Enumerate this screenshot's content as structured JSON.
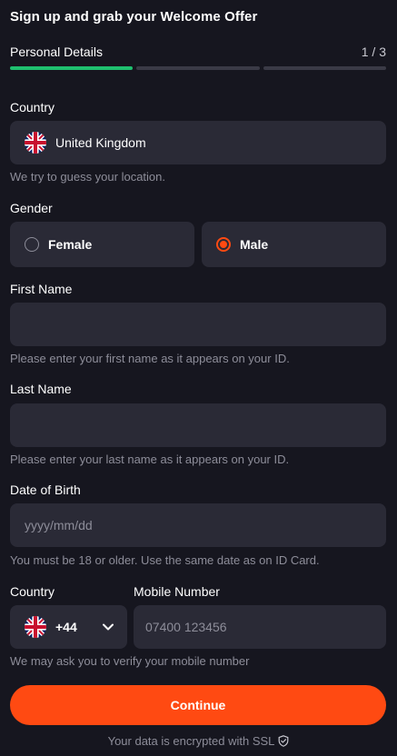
{
  "header": {
    "title": "Sign up and grab your Welcome Offer"
  },
  "steps": {
    "label": "Personal Details",
    "counter": "1 / 3",
    "total": 3,
    "current": 1
  },
  "country": {
    "label": "Country",
    "value": "United Kingdom",
    "flag_icon": "uk-flag-icon",
    "hint": "We try to guess your location."
  },
  "gender": {
    "label": "Gender",
    "options": [
      {
        "label": "Female",
        "selected": false
      },
      {
        "label": "Male",
        "selected": true
      }
    ]
  },
  "first_name": {
    "label": "First Name",
    "value": "",
    "hint": "Please enter your first name as it appears on your ID."
  },
  "last_name": {
    "label": "Last Name",
    "value": "",
    "hint": "Please enter your last name as it appears on your ID."
  },
  "dob": {
    "label": "Date of Birth",
    "placeholder": "yyyy/mm/dd",
    "hint": "You must be 18 or older. Use the same date as on ID Card."
  },
  "phone": {
    "country_label": "Country",
    "code": "+44",
    "mobile_label": "Mobile Number",
    "placeholder": "07400 123456",
    "hint": "We may ask you to verify your mobile number"
  },
  "continue_label": "Continue",
  "footer": {
    "ssl_text": "Your data is encrypted with SSL"
  },
  "colors": {
    "background": "#16161f",
    "field": "#2a2a36",
    "accent": "#ff4a12",
    "progress_active": "#1fbf6f",
    "hint": "#8d8d99"
  }
}
